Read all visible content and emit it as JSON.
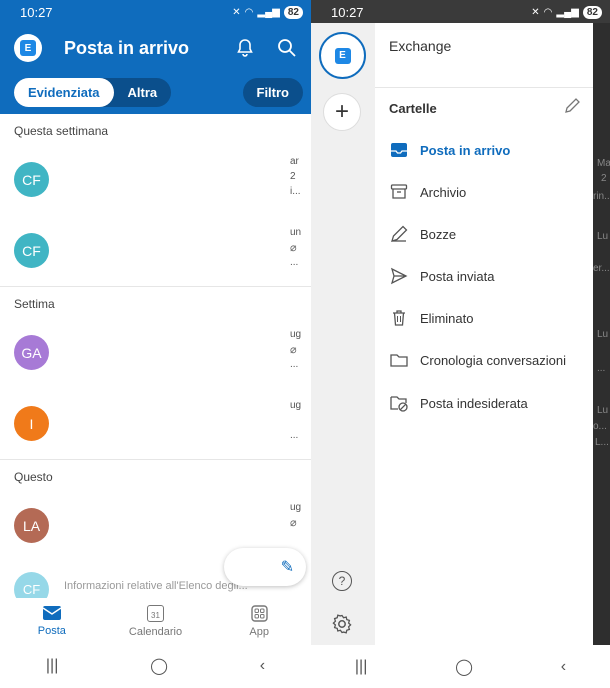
{
  "left": {
    "status": {
      "time": "10:27",
      "battery": "82"
    },
    "header": {
      "title": "Posta in arrivo"
    },
    "tabs": {
      "focused": "Evidenziata",
      "other": "Altra",
      "filter": "Filtro"
    },
    "sections": [
      "Questa settimana",
      "Settima",
      "Questo"
    ],
    "mails": [
      {
        "initials": "CF",
        "color": "#40b5c4",
        "peek1": "ar",
        "peek2": "2",
        "peek3": "i..."
      },
      {
        "initials": "CF",
        "color": "#40b5c4",
        "peek1": "un",
        "peek3": "..."
      },
      {
        "initials": "GA",
        "color": "#a77ad6",
        "peek1": "ug",
        "peek3": "..."
      },
      {
        "initials": "I",
        "color": "#f07a1a",
        "peek1": "ug",
        "peek3": "..."
      },
      {
        "initials": "LA",
        "color": "#b46a55",
        "peek1": "ug"
      }
    ],
    "ghost": {
      "initials": "CF",
      "text": "Informazioni relative all'Elenco degli..."
    },
    "nav": {
      "mail": "Posta",
      "calendar": "Calendario",
      "calendar_day": "31",
      "apps": "App"
    }
  },
  "right": {
    "status": {
      "time": "10:27",
      "battery": "82"
    },
    "account_name": "Exchange",
    "folders_title": "Cartelle",
    "folders": [
      {
        "label": "Posta in arrivo",
        "icon": "inbox-icon",
        "active": true
      },
      {
        "label": "Archivio",
        "icon": "archive-icon"
      },
      {
        "label": "Bozze",
        "icon": "drafts-icon"
      },
      {
        "label": "Posta inviata",
        "icon": "sent-icon"
      },
      {
        "label": "Eliminato",
        "icon": "trash-icon"
      },
      {
        "label": "Cronologia conversazioni",
        "icon": "folder-icon"
      },
      {
        "label": "Posta indesiderata",
        "icon": "junk-folder-icon"
      }
    ],
    "shade_peeks": [
      "Ma",
      "2",
      "rin...",
      "Lu",
      "er...",
      "Lu",
      "...",
      "Lu",
      "o...",
      "L..."
    ]
  },
  "colors": {
    "brand": "#0f6cbd",
    "dark_brand": "#0b4f8c"
  }
}
